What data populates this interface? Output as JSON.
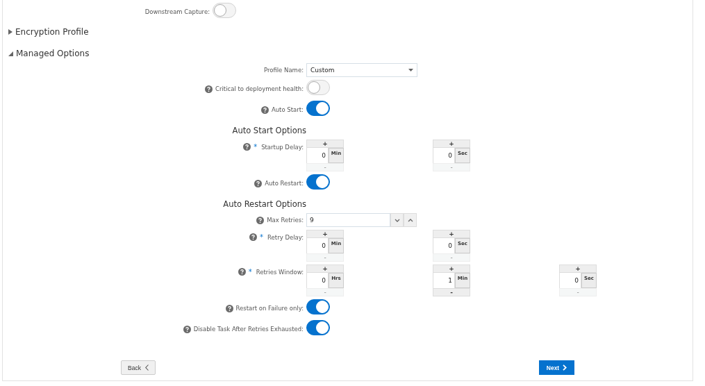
{
  "top_fields": [
    {
      "kind": "toggle",
      "label": "Downstream Capture:",
      "on": false
    }
  ],
  "sections": [
    {
      "title": "Encryption Profile",
      "expanded": false
    },
    {
      "title": "Managed Options",
      "expanded": true,
      "rows": [
        {
          "kind": "select",
          "label": "Profile Name:",
          "help": false,
          "value": "Custom"
        },
        {
          "kind": "toggle",
          "label": "Critical to deployment health:",
          "help": true,
          "on": false
        },
        {
          "kind": "toggle",
          "label": "Auto Start:",
          "help": true,
          "on": true
        },
        {
          "kind": "heading",
          "label": "Auto Start Options"
        },
        {
          "kind": "spinners",
          "label": "Startup Delay:",
          "help": true,
          "required_mark": "*",
          "spinners": [
            {
              "plus": "+",
              "value": "0",
              "unit": "Min",
              "minus": "-",
              "minus_disabled": true
            },
            {
              "plus": "+",
              "value": "0",
              "unit": "Sec",
              "minus": "-",
              "minus_disabled": true
            }
          ]
        },
        {
          "kind": "toggle",
          "label": "Auto Restart:",
          "help": true,
          "on": true
        },
        {
          "kind": "heading",
          "label": "Auto Restart Options"
        },
        {
          "kind": "number",
          "label": "Max Retries:",
          "help": true,
          "value": "9"
        },
        {
          "kind": "spinners",
          "label": "Retry Delay:",
          "help": true,
          "required_mark": "*",
          "spinners": [
            {
              "plus": "+",
              "value": "0",
              "unit": "Min",
              "minus": "-",
              "minus_disabled": true
            },
            {
              "plus": "+",
              "value": "0",
              "unit": "Sec",
              "minus": "-",
              "minus_disabled": true
            }
          ]
        },
        {
          "kind": "spinners",
          "label": "Retries Window:",
          "help": true,
          "required_mark": "*",
          "spinners": [
            {
              "plus": "+",
              "value": "0",
              "unit": "Hrs",
              "minus": "-",
              "minus_disabled": true
            },
            {
              "plus": "+",
              "value": "1",
              "unit": "Min",
              "minus": "-",
              "minus_disabled": false
            },
            {
              "plus": "+",
              "value": "0",
              "unit": "Sec",
              "minus": "-",
              "minus_disabled": true
            }
          ]
        },
        {
          "kind": "toggle",
          "label": "Restart on Failure only:",
          "help": true,
          "on": true
        },
        {
          "kind": "toggle",
          "label": "Disable Task After Retries Exhausted:",
          "help": true,
          "on": true
        }
      ]
    }
  ],
  "buttons": {
    "back": "Back",
    "next": "Next"
  }
}
